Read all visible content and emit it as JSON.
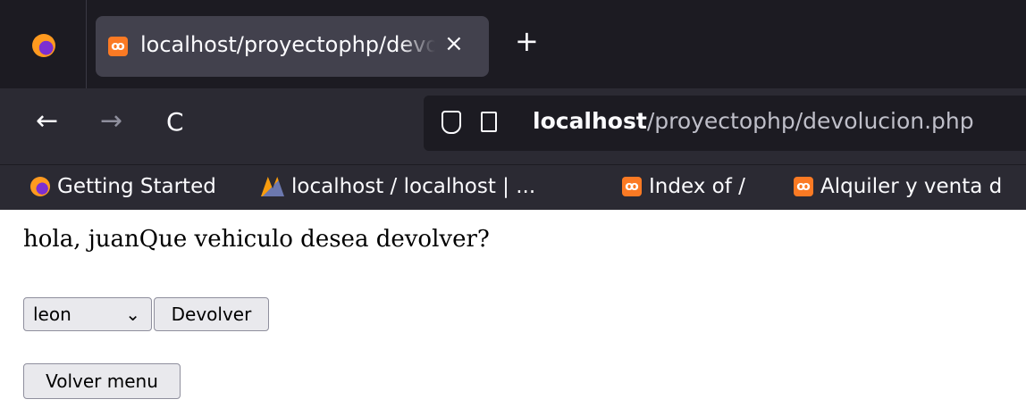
{
  "browser": {
    "tab": {
      "title": "localhost/proyectophp/devolucion.php",
      "favicon_glyph": "ꝏ",
      "close_glyph": "×"
    },
    "new_tab_glyph": "+",
    "nav": {
      "back_glyph": "←",
      "forward_glyph": "→",
      "reload_glyph": "C"
    },
    "url": {
      "host": "localhost",
      "path": "/proyectophp/devolucion.php"
    },
    "bookmarks": [
      {
        "label": "Getting Started",
        "icon": "firefox-icon"
      },
      {
        "label": "localhost / localhost | ...",
        "icon": "phpmyadmin-icon"
      },
      {
        "label": "Index of /",
        "icon": "xampp-icon"
      },
      {
        "label": "Alquiler y venta d",
        "icon": "xampp-icon"
      }
    ]
  },
  "page": {
    "greeting": "hola, juanQue vehiculo desea devolver?",
    "vehicle_select_value": "leon",
    "chevron_glyph": "⌄",
    "return_button_label": "Devolver",
    "back_menu_button_label": "Volver menu"
  }
}
